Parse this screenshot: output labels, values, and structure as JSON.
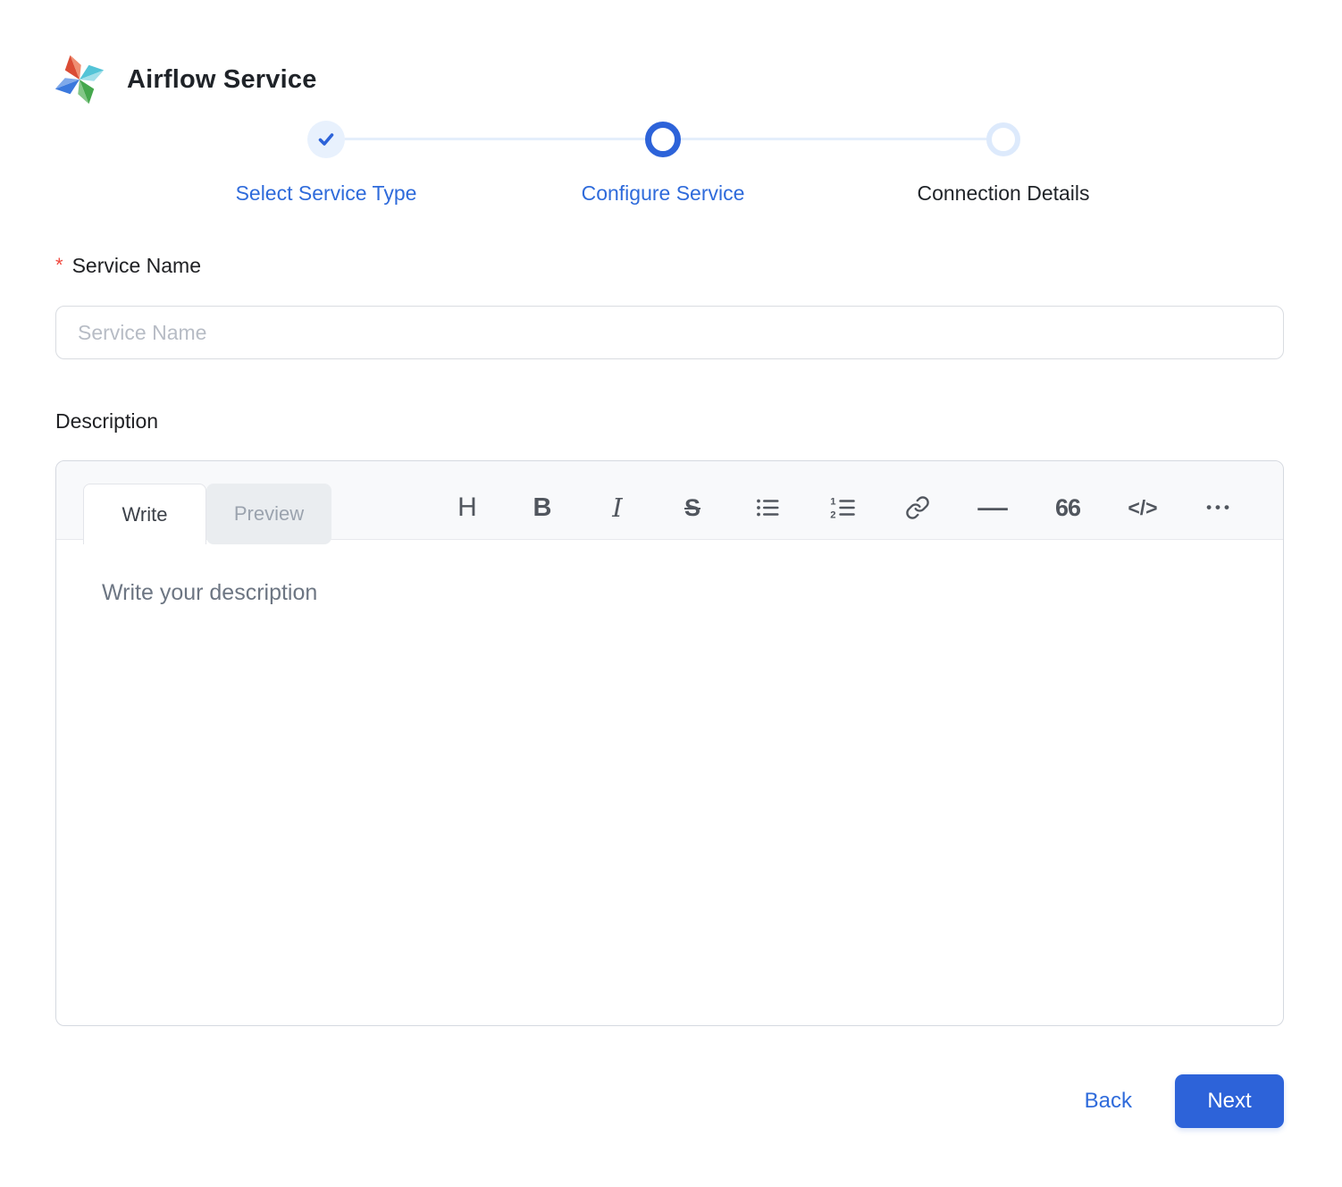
{
  "brand": {
    "title": "Airflow Service",
    "logo_icon": "airflow-pinwheel-logo"
  },
  "stepper": {
    "steps": [
      {
        "label": "Select Service Type",
        "state": "completed",
        "icon": "check-icon"
      },
      {
        "label": "Configure Service",
        "state": "active",
        "icon": "ring-circle"
      },
      {
        "label": "Connection Details",
        "state": "upcoming",
        "icon": "ring-circle"
      }
    ]
  },
  "form": {
    "service_name": {
      "required_marker": "*",
      "label": "Service Name",
      "placeholder": "Service Name",
      "value": ""
    },
    "description": {
      "label": "Description",
      "placeholder": "Write your description",
      "value": ""
    }
  },
  "editor": {
    "tabs": [
      {
        "label": "Write",
        "active": true
      },
      {
        "label": "Preview",
        "active": false
      }
    ],
    "toolbar": {
      "icons": [
        {
          "name": "heading-icon",
          "glyph": "H"
        },
        {
          "name": "bold-icon",
          "glyph": "B"
        },
        {
          "name": "italic-icon",
          "glyph": "I"
        },
        {
          "name": "strikethrough-icon",
          "glyph": "S"
        },
        {
          "name": "unordered-list-icon",
          "glyph": ""
        },
        {
          "name": "ordered-list-icon",
          "glyph": ""
        },
        {
          "name": "link-icon",
          "glyph": ""
        },
        {
          "name": "horizontal-rule-icon",
          "glyph": "—"
        },
        {
          "name": "quote-icon",
          "glyph": "66"
        },
        {
          "name": "code-icon",
          "glyph": "</>"
        },
        {
          "name": "more-options-icon",
          "glyph": "•••"
        }
      ]
    }
  },
  "footer": {
    "back_label": "Back",
    "next_label": "Next"
  },
  "colors": {
    "primary_blue": "#2d63d9",
    "step_label_blue": "#2f6bdb",
    "completed_step_bg": "#e8f1fd",
    "stepper_track": "#e4eefb",
    "upcoming_ring": "#ddeafc",
    "required_asterisk": "#f0483e",
    "logo_red": "#db4c35",
    "logo_teal": "#53c4d7",
    "logo_green": "#45a74d",
    "logo_blue": "#3b79dd"
  }
}
